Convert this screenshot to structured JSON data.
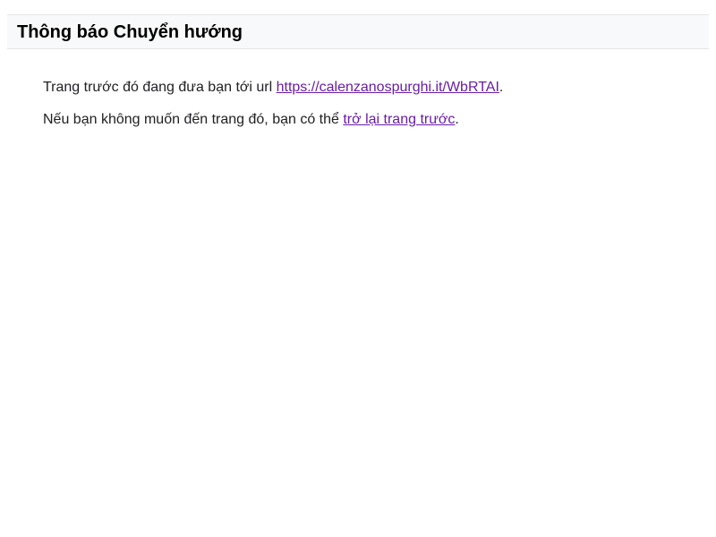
{
  "header": {
    "title": "Thông báo Chuyển hướng"
  },
  "message": {
    "line1_prefix": "Trang trước đó đang đưa bạn tới url ",
    "redirect_url": "https://calenzanospurghi.it/WbRTAI",
    "line1_suffix": ".",
    "line2_prefix": "Nếu bạn không muốn đến trang đó, bạn có thể ",
    "back_link_label": "trở lại trang trước",
    "line2_suffix": "."
  },
  "colors": {
    "link": "#681da8",
    "header_background": "#f8f9fa",
    "text": "#202124"
  }
}
